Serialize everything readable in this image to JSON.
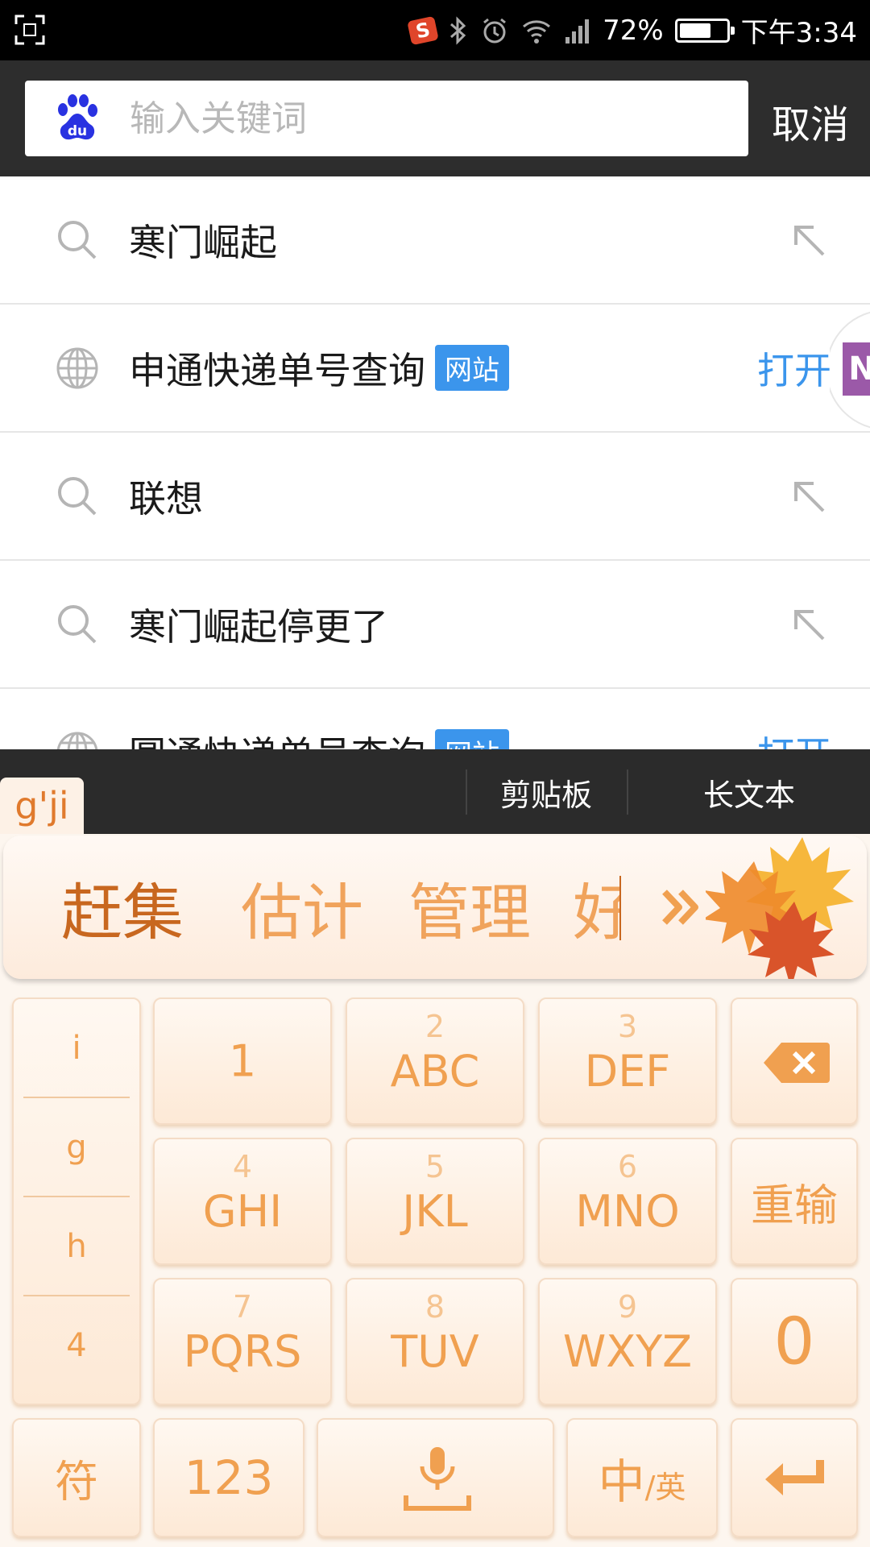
{
  "status_bar": {
    "battery": "72%",
    "battery_level": 0.72,
    "time": "下午3:34",
    "icons": [
      "screenshot-icon",
      "sogou-icon",
      "bluetooth-icon",
      "alarm-icon",
      "wifi-icon",
      "signal-icon",
      "battery-icon"
    ]
  },
  "search": {
    "placeholder": "输入关键词",
    "value": "",
    "cancel_label": "取消"
  },
  "suggestions": [
    {
      "type": "query",
      "text": "寒门崛起",
      "icon": "search-icon",
      "action_icon": "fill-arrow-icon"
    },
    {
      "type": "site",
      "text": "申通快递单号查询",
      "tag": "网站",
      "icon": "globe-icon",
      "action": "打开"
    },
    {
      "type": "query",
      "text": "联想",
      "icon": "search-icon",
      "action_icon": "fill-arrow-icon"
    },
    {
      "type": "query",
      "text": "寒门崛起停更了",
      "icon": "search-icon",
      "action_icon": "fill-arrow-icon"
    },
    {
      "type": "site",
      "text": "圆通快递单号查询",
      "tag": "网站",
      "icon": "globe-icon",
      "action": "打开"
    }
  ],
  "keyboard": {
    "pinyin": "g'ji",
    "toolbar": {
      "clipboard": "剪贴板",
      "long_text": "长文本"
    },
    "candidates": [
      "赶集",
      "估计",
      "管理",
      "好"
    ],
    "side_letters": [
      "i",
      "g",
      "h",
      "4"
    ],
    "keys": {
      "k1": {
        "label": "1"
      },
      "k2": {
        "num": "2",
        "label": "ABC"
      },
      "k3": {
        "num": "3",
        "label": "DEF"
      },
      "k4": {
        "num": "4",
        "label": "GHI"
      },
      "k5": {
        "num": "5",
        "label": "JKL"
      },
      "k6": {
        "num": "6",
        "label": "MNO"
      },
      "k7": {
        "num": "7",
        "label": "PQRS"
      },
      "k8": {
        "num": "8",
        "label": "TUV"
      },
      "k9": {
        "num": "9",
        "label": "WXYZ"
      },
      "retype": "重输",
      "zero": "0",
      "symbols": "符",
      "numbers": "123",
      "lang_main": "中",
      "lang_alt": "/英"
    },
    "colors": {
      "accent": "#f0a050",
      "accent_dark": "#c8671f",
      "link": "#3b95ec"
    }
  }
}
